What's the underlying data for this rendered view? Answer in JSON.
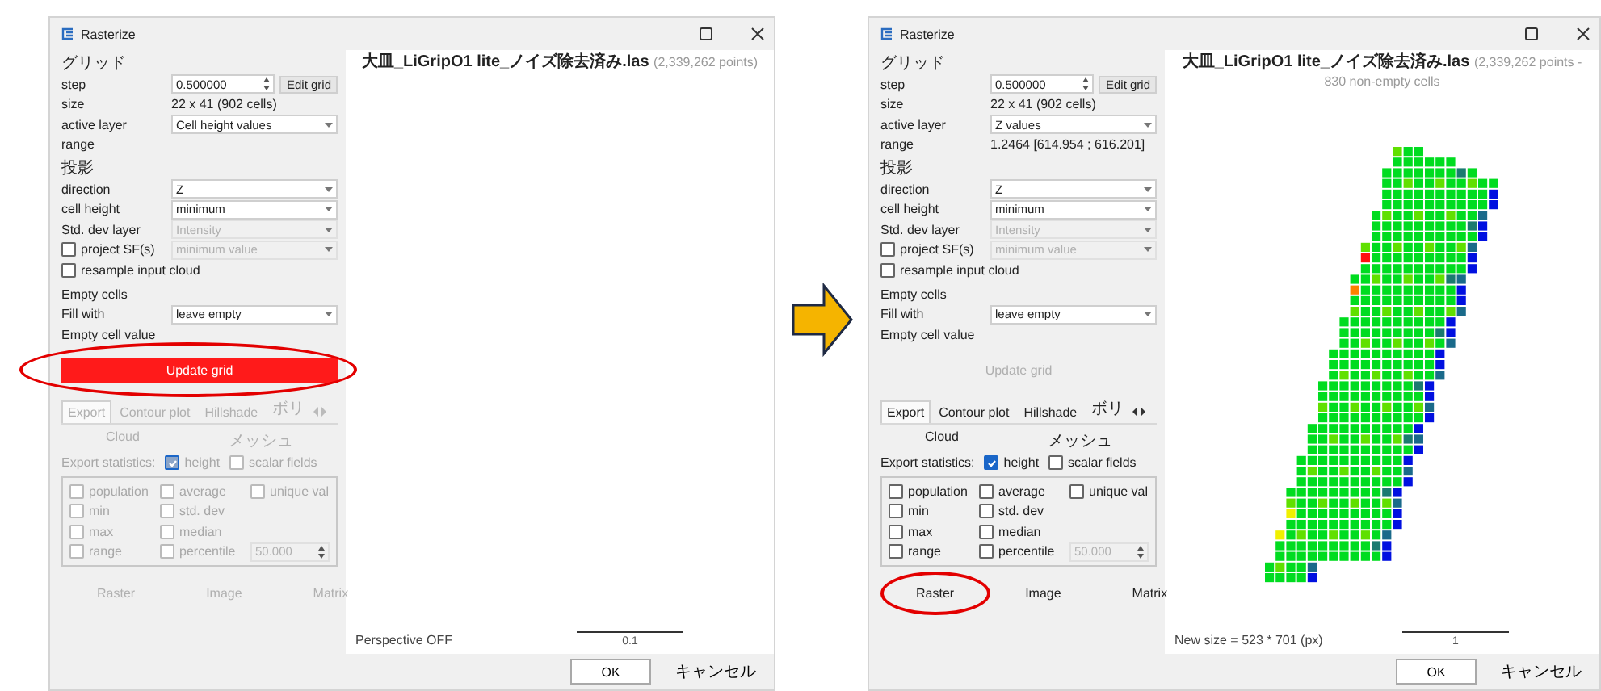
{
  "dialogs": [
    {
      "title": "Rasterize",
      "sections": [
        {
          "heading": "グリッド",
          "rows": [
            {
              "kind": "spin",
              "label": "step",
              "value": "0.500000",
              "button": "Edit grid"
            },
            {
              "kind": "text",
              "label": "size",
              "value": "22 x 41 (902 cells)"
            },
            {
              "kind": "select",
              "label": "active layer",
              "value": "Cell height values",
              "disabled": false
            },
            {
              "kind": "text",
              "label": "range"
            }
          ]
        },
        {
          "heading": "投影",
          "rows": [
            {
              "kind": "select",
              "label": "direction",
              "value": "Z",
              "disabled": false
            },
            {
              "kind": "select",
              "label": "cell height",
              "value": "minimum",
              "disabled": false
            },
            {
              "kind": "select",
              "label": "Std. dev layer",
              "value": "Intensity",
              "disabled": true
            },
            {
              "kind": "check",
              "label": "project SF(s)",
              "checked": false,
              "value": "minimum value",
              "disabled": true
            },
            {
              "kind": "check",
              "label": "resample input cloud",
              "checked": false
            }
          ]
        },
        {
          "heading": "Empty cells",
          "rows": [
            {
              "kind": "select",
              "label": "Fill with",
              "value": "leave empty",
              "disabled": false
            },
            {
              "kind": "text",
              "label": "Empty cell value"
            }
          ]
        }
      ],
      "update_button": {
        "label": "Update grid",
        "highlighted": true,
        "circled": true
      },
      "export_disabled": true,
      "tabs": [
        {
          "label": "Export",
          "selected": true
        },
        {
          "label": "Contour plot",
          "selected": false
        },
        {
          "label": "Hillshade",
          "selected": false
        },
        {
          "label": "ボリ",
          "selected": false
        }
      ],
      "targets": [
        "Cloud",
        "メッシュ"
      ],
      "stats_label": "Export statistics:",
      "height": {
        "label": "height",
        "checked": true
      },
      "scalar": {
        "label": "scalar fields",
        "checked": false
      },
      "stats_rows": [
        {
          "items": [
            {
              "kind": "check",
              "label": "population",
              "checked": false
            },
            {
              "kind": "check",
              "label": "average",
              "checked": false
            },
            {
              "kind": "check",
              "label": "unique val",
              "checked": false
            }
          ]
        },
        {
          "items": [
            {
              "kind": "check",
              "label": "min",
              "checked": false
            },
            {
              "kind": "check",
              "label": "std. dev",
              "checked": false
            }
          ]
        },
        {
          "items": [
            {
              "kind": "check",
              "label": "max",
              "checked": false
            },
            {
              "kind": "check",
              "label": "median",
              "checked": false
            }
          ]
        },
        {
          "items": [
            {
              "kind": "check",
              "label": "range",
              "checked": false
            },
            {
              "kind": "check",
              "label": "percentile",
              "checked": false
            },
            {
              "kind": "spin",
              "value": "50.000"
            }
          ]
        }
      ],
      "buttons": [
        {
          "label": "Raster",
          "circled": false
        },
        {
          "label": "Image",
          "circled": false
        },
        {
          "label": "Matrix",
          "circled": false
        }
      ],
      "view": {
        "title": "大皿_LiGripO1 lite_ノイズ除去済み.las",
        "info": "(2,339,262 points)",
        "raster_shown": false,
        "status": "Perspective OFF",
        "scale": "0.1"
      },
      "footer": [
        "OK",
        "キャンセル"
      ]
    },
    {
      "title": "Rasterize",
      "sections": [
        {
          "heading": "グリッド",
          "rows": [
            {
              "kind": "spin",
              "label": "step",
              "value": "0.500000",
              "button": "Edit grid"
            },
            {
              "kind": "text",
              "label": "size",
              "value": "22 x 41 (902 cells)"
            },
            {
              "kind": "select",
              "label": "active layer",
              "value": "Z values",
              "disabled": false
            },
            {
              "kind": "text",
              "label": "range",
              "value": "1.2464 [614.954 ; 616.201]"
            }
          ]
        },
        {
          "heading": "投影",
          "rows": [
            {
              "kind": "select",
              "label": "direction",
              "value": "Z",
              "disabled": false
            },
            {
              "kind": "select",
              "label": "cell height",
              "value": "minimum",
              "disabled": false
            },
            {
              "kind": "select",
              "label": "Std. dev layer",
              "value": "Intensity",
              "disabled": true
            },
            {
              "kind": "check",
              "label": "project SF(s)",
              "checked": false,
              "value": "minimum value",
              "disabled": true
            },
            {
              "kind": "check",
              "label": "resample input cloud",
              "checked": false
            }
          ]
        },
        {
          "heading": "Empty cells",
          "rows": [
            {
              "kind": "select",
              "label": "Fill with",
              "value": "leave empty",
              "disabled": false
            },
            {
              "kind": "text",
              "label": "Empty cell value"
            }
          ]
        }
      ],
      "update_button": {
        "label": "Update grid",
        "highlighted": false,
        "circled": false
      },
      "export_disabled": false,
      "tabs": [
        {
          "label": "Export",
          "selected": true
        },
        {
          "label": "Contour plot",
          "selected": false
        },
        {
          "label": "Hillshade",
          "selected": false
        },
        {
          "label": "ボリ",
          "selected": false
        }
      ],
      "targets": [
        "Cloud",
        "メッシュ"
      ],
      "stats_label": "Export statistics:",
      "height": {
        "label": "height",
        "checked": true
      },
      "scalar": {
        "label": "scalar fields",
        "checked": false
      },
      "stats_rows": [
        {
          "items": [
            {
              "kind": "check",
              "label": "population",
              "checked": false
            },
            {
              "kind": "check",
              "label": "average",
              "checked": false
            },
            {
              "kind": "check",
              "label": "unique val",
              "checked": false
            }
          ]
        },
        {
          "items": [
            {
              "kind": "check",
              "label": "min",
              "checked": false
            },
            {
              "kind": "check",
              "label": "std. dev",
              "checked": false
            }
          ]
        },
        {
          "items": [
            {
              "kind": "check",
              "label": "max",
              "checked": false
            },
            {
              "kind": "check",
              "label": "median",
              "checked": false
            }
          ]
        },
        {
          "items": [
            {
              "kind": "check",
              "label": "range",
              "checked": false
            },
            {
              "kind": "check",
              "label": "percentile",
              "checked": false
            },
            {
              "kind": "spin",
              "value": "50.000"
            }
          ]
        }
      ],
      "buttons": [
        {
          "label": "Raster",
          "circled": true
        },
        {
          "label": "Image",
          "circled": false
        },
        {
          "label": "Matrix",
          "circled": false
        }
      ],
      "view": {
        "title": "大皿_LiGripO1 lite_ノイズ除去済み.las",
        "info": "(2,339,262 points - 830 non-empty cells",
        "raster_shown": true,
        "status": "New size = 523 * 701 (px)",
        "scale": "1"
      },
      "footer": [
        "OK",
        "キャンセル"
      ]
    }
  ]
}
